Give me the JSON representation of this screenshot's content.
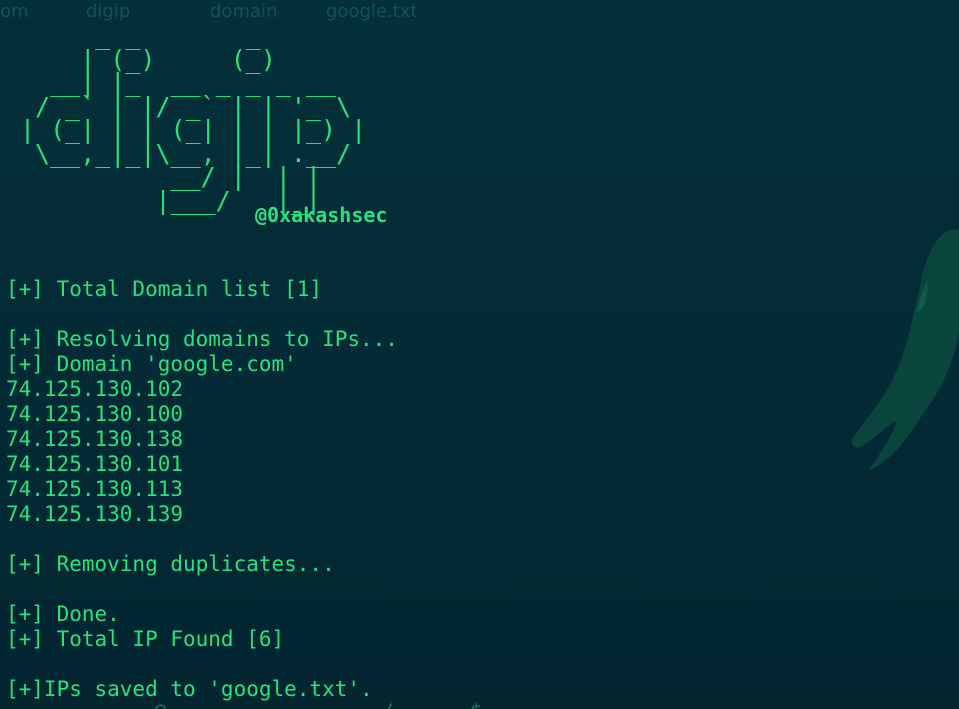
{
  "theme": {
    "background": "#032a35",
    "text_color": "#27e27d"
  },
  "top_residue": {
    "ghost_1": "om",
    "ghost_2": "digip",
    "ghost_3": "domain",
    "ghost_4": "google.txt"
  },
  "banner": {
    "ascii_art": "     _ _       _       \n    | (_)     (_)      \n  __| |_  __ _ _ _ __  \n / _` | |/ _` | | '_ \\ \n| (_| | | (_| | | |_) |\n \\__,_|_|\\__, |_| .__/ \n          __/ |  | |    \n         |___/   |_|    ",
    "author": "@0xakashsec"
  },
  "output": {
    "lines": [
      "[+] Total Domain list [1]",
      "",
      "[+] Resolving domains to IPs...",
      "[+] Domain 'google.com'",
      "74.125.130.102",
      "74.125.130.100",
      "74.125.130.138",
      "74.125.130.101",
      "74.125.130.113",
      "74.125.130.139",
      "",
      "[+] Removing duplicates...",
      "",
      "[+] Done.",
      "[+] Total IP Found [6]",
      "",
      "[+]IPs saved to 'google.txt'."
    ]
  },
  "bottom_residue": {
    "prompt": "  ___       @  _  _  _       _/   ___$  "
  },
  "icons": {
    "background": "dragon-watermark-icon"
  }
}
